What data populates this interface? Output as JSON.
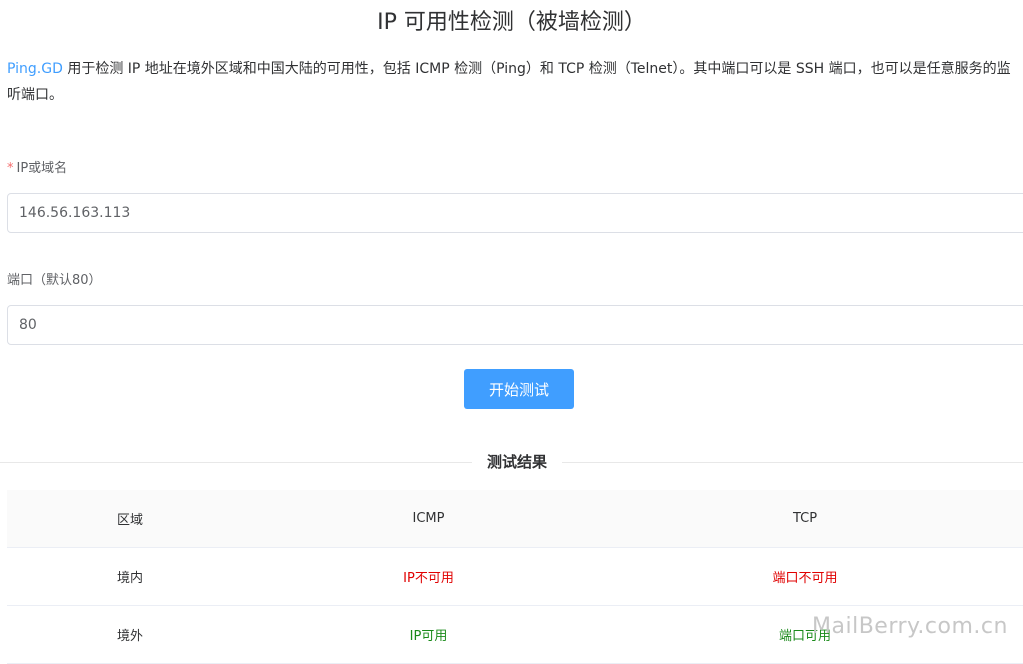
{
  "page": {
    "title": "IP 可用性检测（被墙检测）",
    "desc_link": "Ping.GD",
    "desc_text": " 用于检测 IP 地址在境外区域和中国大陆的可用性，包括 ICMP 检测（Ping）和 TCP 检测（Telnet）。其中端口可以是 SSH 端口，也可以是任意服务的监听端口。"
  },
  "form": {
    "ip_label": "IP或域名",
    "ip_value": "146.56.163.113",
    "port_label": "端口（默认80）",
    "port_value": "80",
    "submit_label": "开始测试"
  },
  "results": {
    "heading": "测试结果",
    "headers": [
      "区域",
      "ICMP",
      "TCP"
    ],
    "rows": [
      {
        "region": "境内",
        "icmp": "IP不可用",
        "tcp": "端口不可用",
        "icmp_color": "#e00000",
        "tcp_color": "#e00000"
      },
      {
        "region": "境外",
        "icmp": "IP可用",
        "tcp": "端口可用",
        "icmp_color": "#1a8a1a",
        "tcp_color": "#1a8a1a"
      }
    ]
  },
  "watermark": "MailBerry.com.cn",
  "colors": {
    "accent": "#409eff",
    "required": "#f56c6c"
  }
}
